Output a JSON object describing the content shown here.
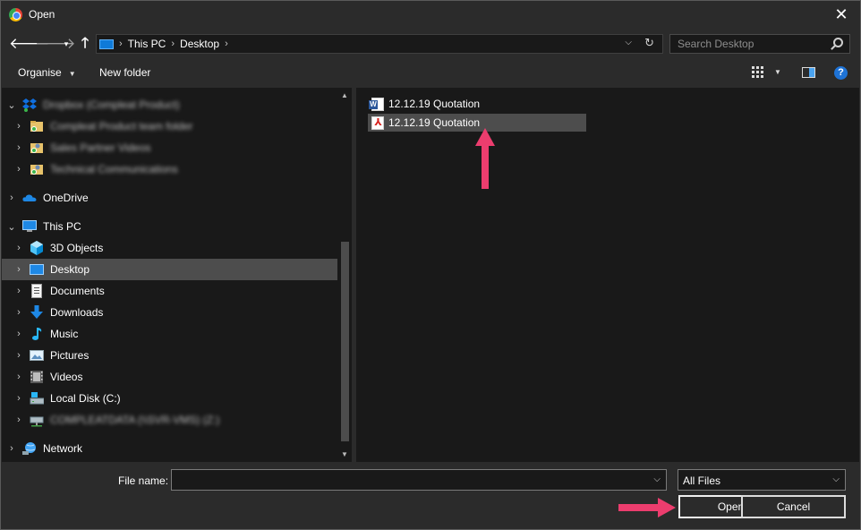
{
  "window": {
    "title": "Open",
    "app_icon": "chrome-icon",
    "close_glyph": "✕"
  },
  "nav": {
    "back": "🡐",
    "forward": "🡒",
    "recent": "▾",
    "up": "🡑"
  },
  "address": {
    "crumbs": [
      "This PC",
      "Desktop"
    ],
    "separator": "›",
    "dropdown": "⌵",
    "refresh": "↻"
  },
  "search": {
    "placeholder": "Search Desktop"
  },
  "toolbar": {
    "organise": "Organise",
    "organise_dd": "▼",
    "new_folder": "New folder",
    "view_dd": "▼",
    "help": "?"
  },
  "tree": {
    "chevron_closed": "›",
    "chevron_open": "⌄",
    "items": [
      {
        "label": "Dropbox (Compleat Product)",
        "blurred": true
      },
      {
        "label": "Compleat Product team folder",
        "blurred": true
      },
      {
        "label": "Sales Partner Videos",
        "blurred": true
      },
      {
        "label": "Technical Communications",
        "blurred": true
      },
      {
        "label": "OneDrive"
      },
      {
        "label": "This PC"
      },
      {
        "label": "3D Objects"
      },
      {
        "label": "Desktop"
      },
      {
        "label": "Documents"
      },
      {
        "label": "Downloads"
      },
      {
        "label": "Music"
      },
      {
        "label": "Pictures"
      },
      {
        "label": "Videos"
      },
      {
        "label": "Local Disk (C:)"
      },
      {
        "label": "COMPLEATDATA (\\\\SVR-VMS) (Z:)",
        "blurred": true
      },
      {
        "label": "Network"
      }
    ],
    "selected": "Desktop"
  },
  "files": [
    {
      "name": "12.12.19 Quotation",
      "type": "word",
      "selected": false
    },
    {
      "name": "12.12.19 Quotation",
      "type": "pdf",
      "selected": true
    }
  ],
  "bottom": {
    "file_name_label": "File name:",
    "file_name_value": "",
    "file_type": "All Files",
    "dropdown": "⌵",
    "open": "Open",
    "cancel": "Cancel"
  },
  "scroll": {
    "up": "▲",
    "down": "▼"
  },
  "colors": {
    "accent": "#ec3d6e",
    "selection": "#4d4d4d",
    "pane_bg": "#191919",
    "chrome_bg": "#2b2b2b"
  }
}
